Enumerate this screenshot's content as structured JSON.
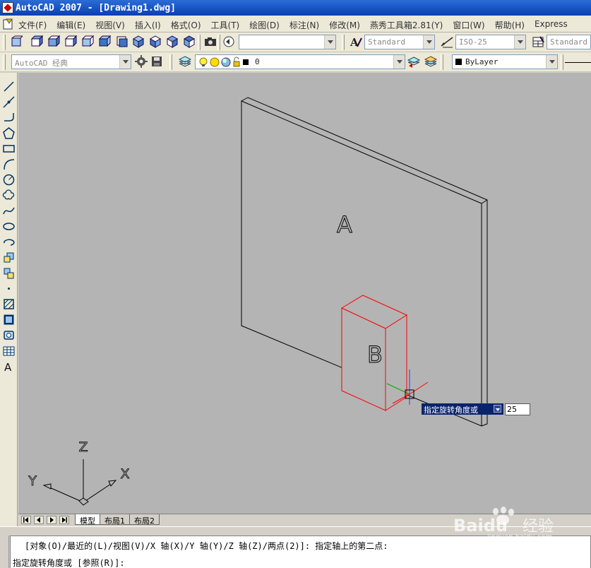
{
  "window": {
    "title": "AutoCAD 2007 - [Drawing1.dwg]"
  },
  "menubar": {
    "items": [
      "文件(F)",
      "编辑(E)",
      "视图(V)",
      "插入(I)",
      "格式(O)",
      "工具(T)",
      "绘图(D)",
      "标注(N)",
      "修改(M)",
      "燕秀工具箱2.81(Y)",
      "窗口(W)",
      "帮助(H)",
      "Express"
    ]
  },
  "toolbar1": {
    "empty_combo": "",
    "text_style": "Standard",
    "dim_style": "ISO-25",
    "table_style": "Standard"
  },
  "toolbar2": {
    "workspace": "AutoCAD 经典",
    "layer": "0",
    "color": "ByLayer"
  },
  "drawing": {
    "panel_label": "A",
    "block_label": "B",
    "ucs": {
      "x": "X",
      "y": "Y",
      "z": "Z"
    },
    "colors": {
      "background": "#b4b4b4",
      "selected": "#ff0000",
      "lines": "#000000"
    }
  },
  "dynamic_input": {
    "prompt": "指定旋转角度或",
    "value": "25"
  },
  "layout_tabs": [
    "模型",
    "布局1",
    "布局2"
  ],
  "command": {
    "history_line": "[对象(O)/最近的(L)/视图(V)/X 轴(X)/Y 轴(Y)/Z 轴(Z)/两点(2)]: 指定轴上的第二点:",
    "prompt_line": "指定旋转角度或 [参照(R)]:"
  },
  "watermark": {
    "brand": "Baidu",
    "brand_cn": "经验",
    "url": "jingyan.baidu.com"
  }
}
